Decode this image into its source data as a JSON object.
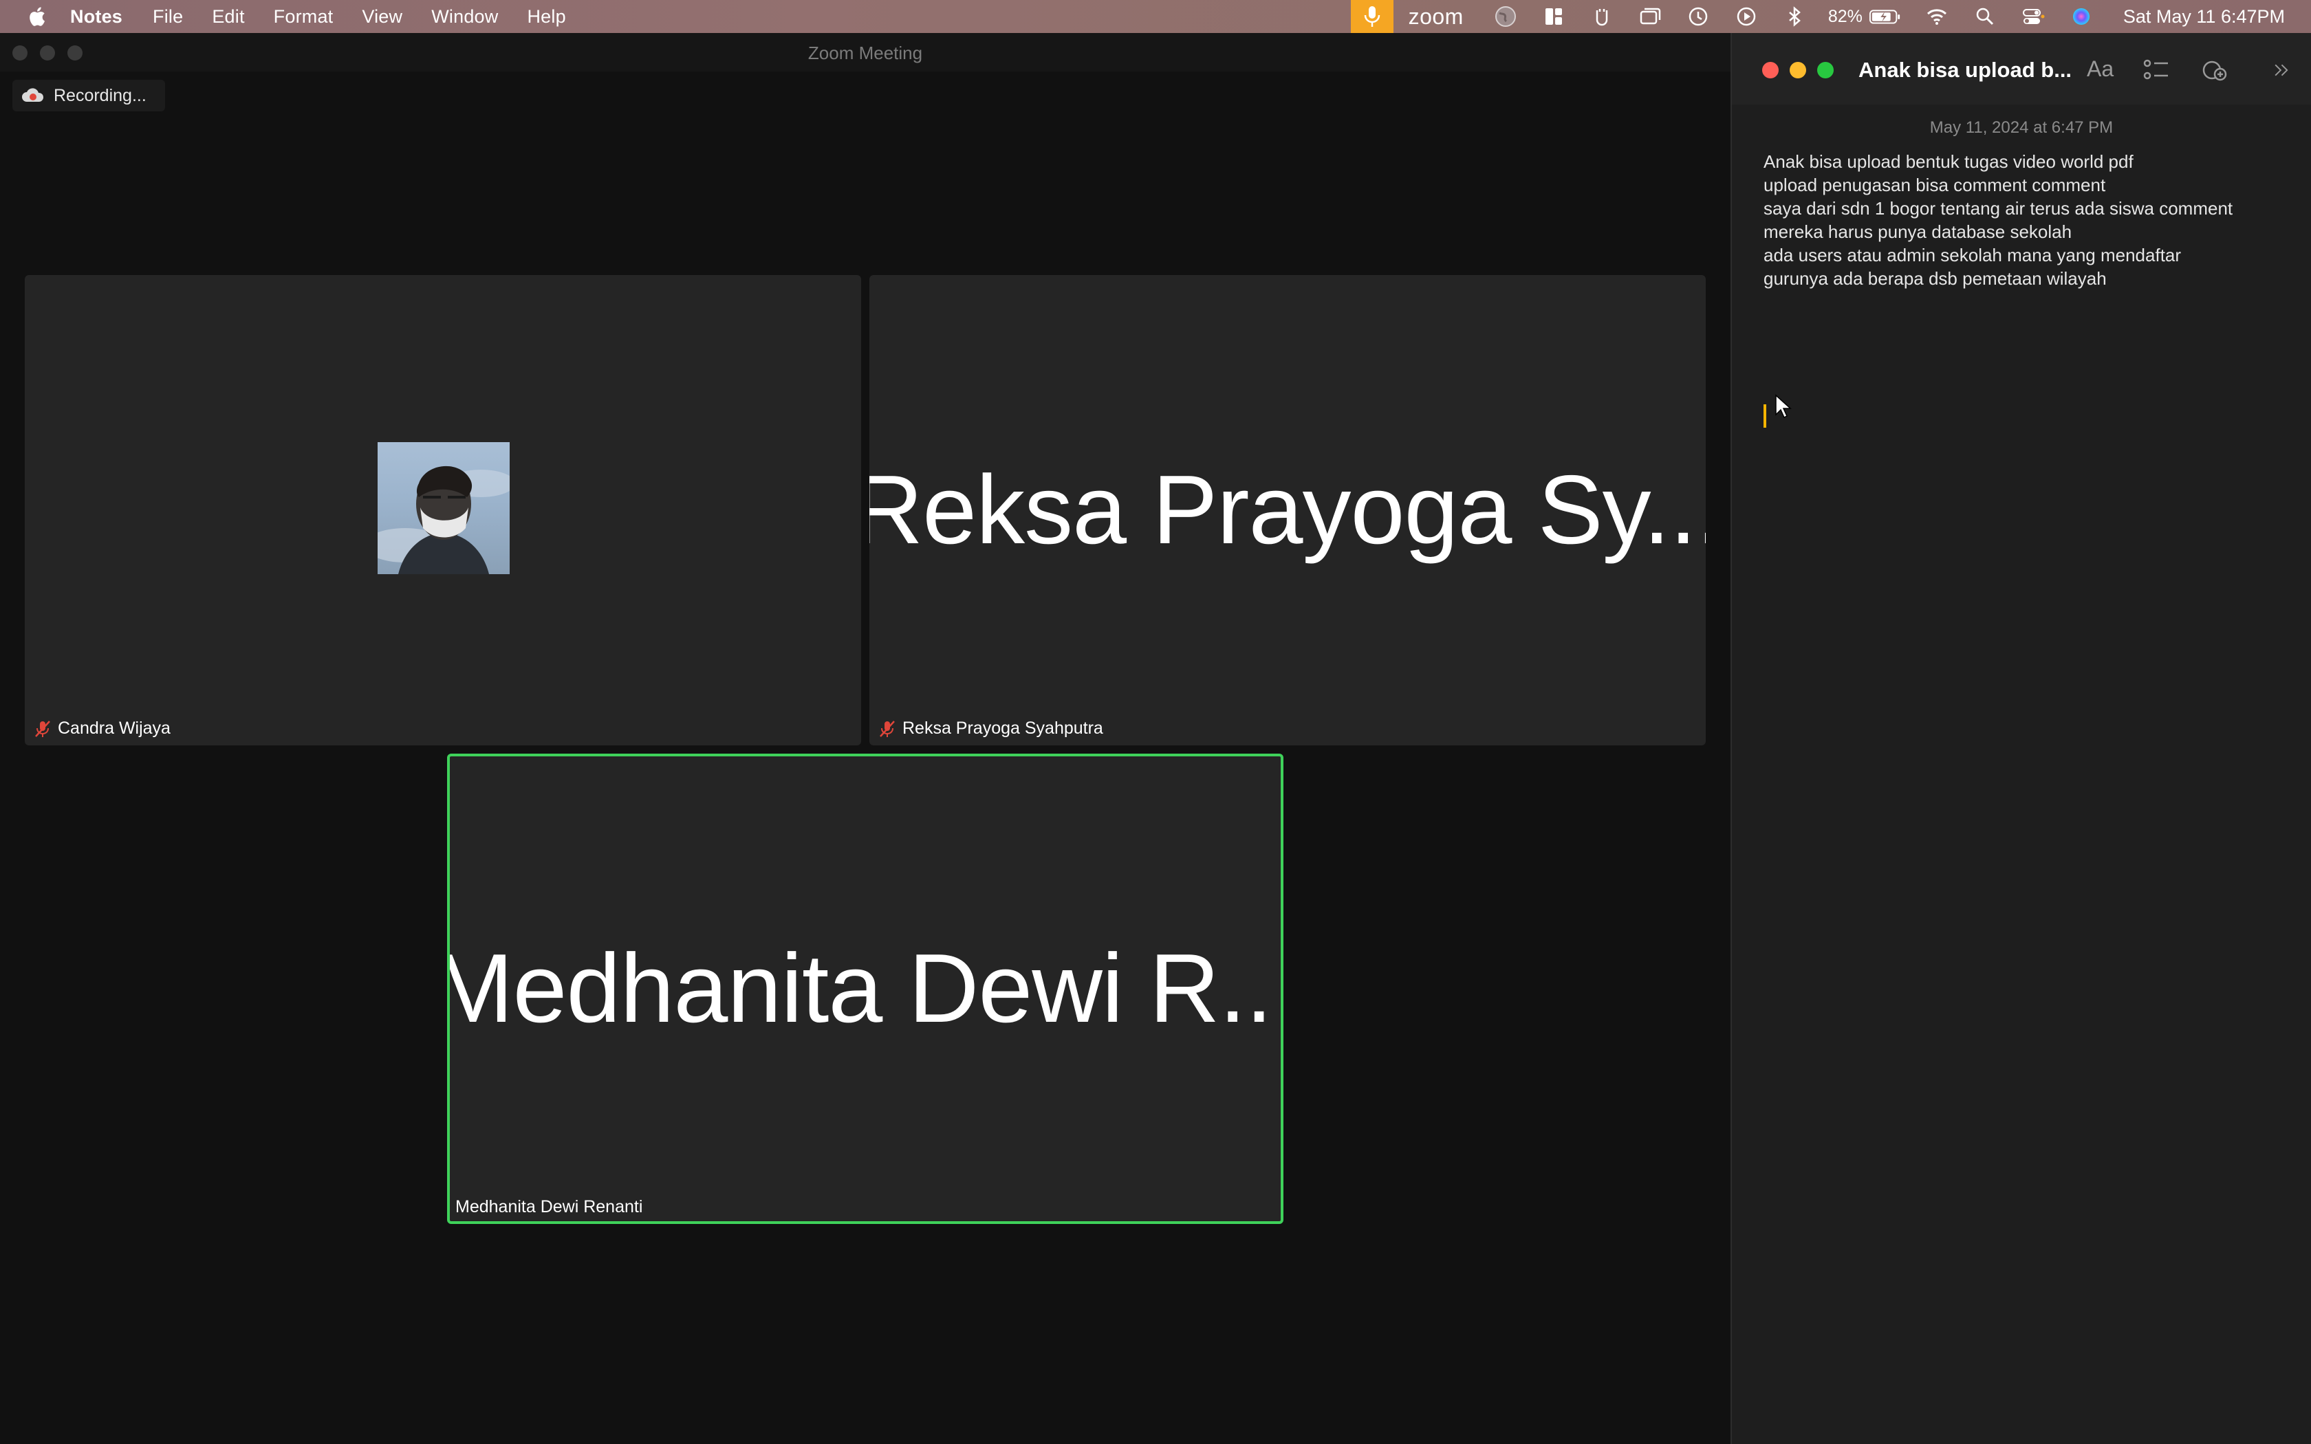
{
  "menubar": {
    "app_name": "Notes",
    "items": [
      "File",
      "Edit",
      "Format",
      "View",
      "Window",
      "Help"
    ],
    "zoom_label": "zoom",
    "battery": "82%",
    "datetime": "Sat May 11  6:47PM",
    "icons": [
      "apple-icon",
      "microphone-icon",
      "globe-icon",
      "window-layout-icon",
      "clipboard-icon",
      "screen-share-icon",
      "time-machine-icon",
      "play-icon",
      "bluetooth-icon",
      "battery-icon",
      "wifi-icon",
      "search-icon",
      "control-center-icon",
      "siri-icon"
    ]
  },
  "zoom": {
    "window_title": "Zoom Meeting",
    "recording_label": "Recording...",
    "participants": [
      {
        "display_name": "",
        "name_tag": "Candra Wijaya",
        "muted": true,
        "has_photo": true
      },
      {
        "display_name": "Reksa Prayoga Sy...",
        "name_tag": "Reksa Prayoga Syahputra",
        "muted": true,
        "has_photo": false
      },
      {
        "display_name": "Medhanita Dewi R...",
        "name_tag": "Medhanita Dewi Renanti",
        "muted": false,
        "has_photo": false,
        "active_speaker": true
      }
    ],
    "colors": {
      "active_border": "#3fd25a",
      "muted_icon": "#e0463a"
    }
  },
  "notes": {
    "title": "Anak bisa upload b...",
    "toolbar": {
      "format_label": "Aa"
    },
    "date": "May 11, 2024 at 6:47 PM",
    "lines": [
      "Anak bisa upload bentuk tugas video world pdf",
      "upload penugasan bisa comment comment",
      "saya dari sdn 1 bogor tentang air terus ada siswa comment",
      "mereka harus punya database sekolah",
      "ada users atau admin sekolah mana yang mendaftar",
      "gurunya ada berapa dsb pemetaan wilayah"
    ]
  }
}
